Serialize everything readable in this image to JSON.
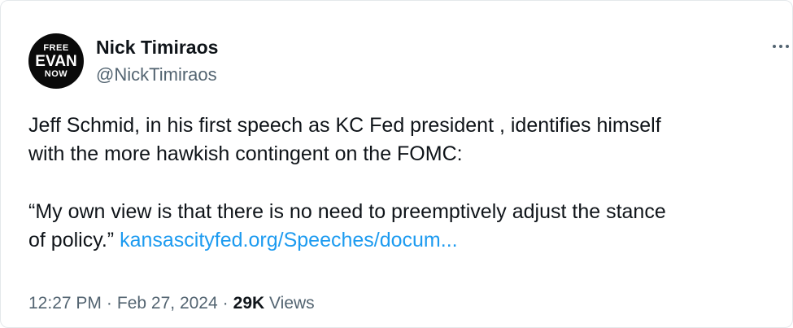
{
  "author": {
    "avatar_lines": [
      "FREE",
      "EVAN",
      "NOW"
    ],
    "display_name": "Nick Timiraos",
    "handle": "@NickTimiraos"
  },
  "more_icon": "more-horizontal-icon",
  "tweet": {
    "line1": "Jeff Schmid, in his first speech as KC Fed president , identifies himself",
    "line2": "with the more hawkish contingent on the FOMC:",
    "line3": "“My own view is that there is no need to preemptively adjust the stance",
    "line4_prefix": "of policy.”",
    "link_text": "kansascityfed.org/Speeches/docum..."
  },
  "meta": {
    "time": "12:27 PM",
    "dot": "·",
    "date": "Feb 27, 2024",
    "views_count": "29K",
    "views_label": "Views"
  },
  "colors": {
    "text": "#0f1419",
    "secondary": "#536471",
    "link": "#1d9bf0",
    "avatar_bg": "#0a0a0a"
  }
}
